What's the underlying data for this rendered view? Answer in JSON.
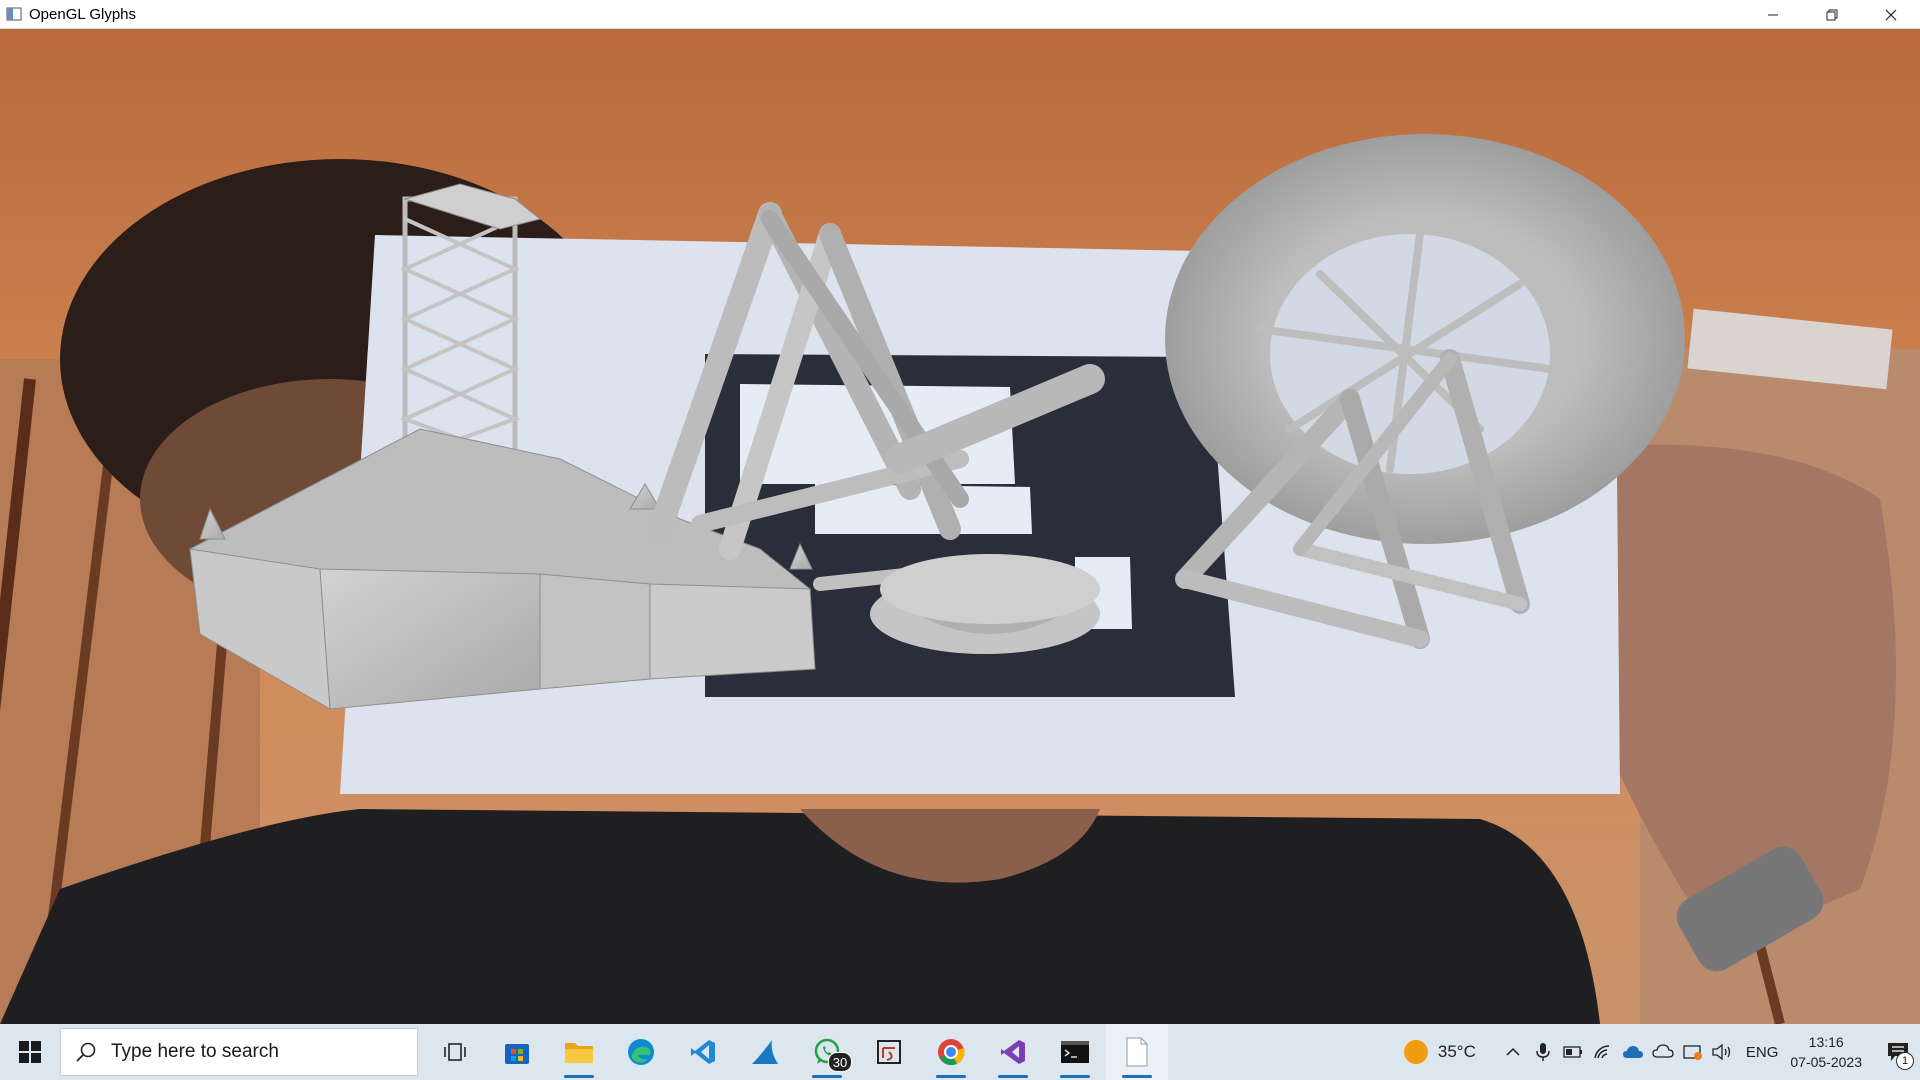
{
  "window": {
    "title": "OpenGL Glyphs",
    "icons": [
      "app-icon",
      "minimize-icon",
      "restore-icon",
      "close-icon"
    ]
  },
  "scene": {
    "description_items": [
      "castle-model",
      "pirate-ship-ride-model",
      "ferris-wheel-model",
      "ar-marker",
      "person"
    ]
  },
  "taskbar": {
    "search_placeholder": "Type here to search",
    "apps": [
      {
        "name": "task-view",
        "icon": "task-view-icon"
      },
      {
        "name": "microsoft-store",
        "icon": "store-icon"
      },
      {
        "name": "file-explorer",
        "icon": "folder-icon",
        "running": true
      },
      {
        "name": "edge",
        "icon": "edge-icon"
      },
      {
        "name": "vscode",
        "icon": "vscode-icon"
      },
      {
        "name": "wireshark",
        "icon": "wireshark-icon"
      },
      {
        "name": "whatsapp",
        "icon": "whatsapp-icon",
        "badge": "30",
        "running": true
      },
      {
        "name": "snipping-tool",
        "icon": "snip-icon"
      },
      {
        "name": "chrome",
        "icon": "chrome-icon",
        "running": true
      },
      {
        "name": "visual-studio",
        "icon": "visual-studio-icon",
        "running": true
      },
      {
        "name": "terminal",
        "icon": "terminal-icon",
        "running": true
      },
      {
        "name": "opengl-glyphs",
        "icon": "blank-app-icon",
        "running": true,
        "active": true
      }
    ],
    "weather": {
      "temp": "35°C",
      "color": "#f39c12"
    },
    "language": "ENG",
    "time": "13:16",
    "date": "07-05-2023",
    "notification_count": "1"
  }
}
